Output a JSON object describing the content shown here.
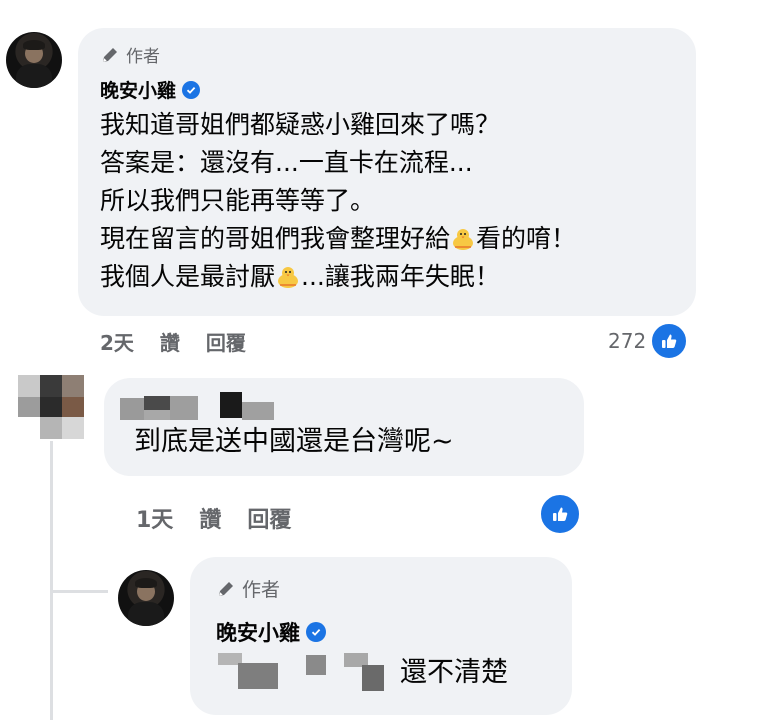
{
  "colors": {
    "bubble": "#f0f2f5",
    "brand_blue": "#1b74e4",
    "meta_gray": "#65676b",
    "text": "#050505"
  },
  "comment1": {
    "author_tag": "作者",
    "author_name": "晚安小雞",
    "lines": [
      "我知道哥姐們都疑惑小雞回來了嗎？",
      "答案是：還沒有...一直卡在流程...",
      "所以我們只能再等等了。"
    ],
    "line4_before": "現在留言的哥姐們我會整理好給",
    "line4_after": "看的唷！",
    "line5_before": "我個人是最討厭",
    "line5_after": "...讓我兩年失眠！",
    "emoji_icon": "baby-chick-emoji",
    "time": "2天",
    "like_label": "讚",
    "reply_label": "回覆",
    "reaction_count": "272"
  },
  "comment2": {
    "text": "到底是送中國還是台灣呢~",
    "time": "1天",
    "like_label": "讚",
    "reply_label": "回覆"
  },
  "reply1": {
    "author_tag": "作者",
    "author_name": "晚安小雞",
    "text": "還不清楚"
  }
}
